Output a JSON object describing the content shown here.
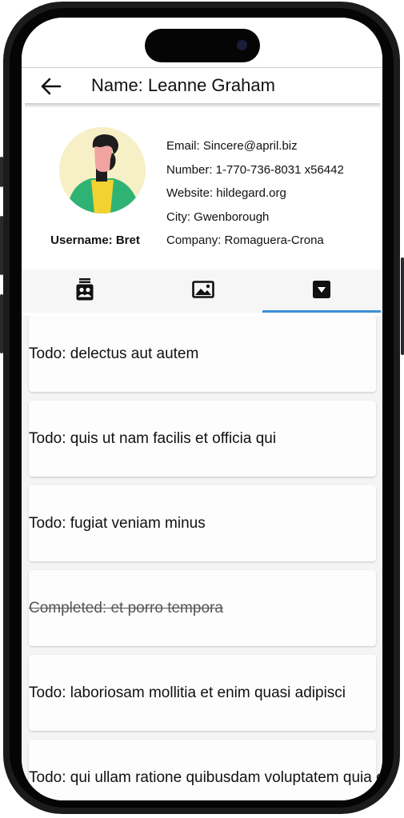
{
  "appbar": {
    "title": "Name: Leanne Graham"
  },
  "profile": {
    "username": "Username: Bret",
    "email": "Email: Sincere@april.biz",
    "number": "Number: 1-770-736-8031 x56442",
    "website": "Website: hildegard.org",
    "city": "City: Gwenborough",
    "company": "Company: Romaguera-Crona"
  },
  "tabs": [
    {
      "icon": "contacts-icon",
      "selected": false
    },
    {
      "icon": "image-icon",
      "selected": false
    },
    {
      "icon": "dropdown-box-icon",
      "selected": true
    }
  ],
  "todos": [
    {
      "text": "Todo: delectus aut autem",
      "completed": false
    },
    {
      "text": "Todo: quis ut nam facilis et officia qui",
      "completed": false
    },
    {
      "text": "Todo: fugiat veniam minus",
      "completed": false
    },
    {
      "text": "Completed: et porro tempora",
      "completed": true
    },
    {
      "text": "Todo: laboriosam mollitia et enim quasi adipisci",
      "completed": false
    },
    {
      "text": "Todo: qui ullam ratione quibusdam voluptatem quia omnis",
      "completed": false
    }
  ],
  "colors": {
    "tab_indicator": "#3b8ed8",
    "avatar_bg": "#f7efc6"
  }
}
